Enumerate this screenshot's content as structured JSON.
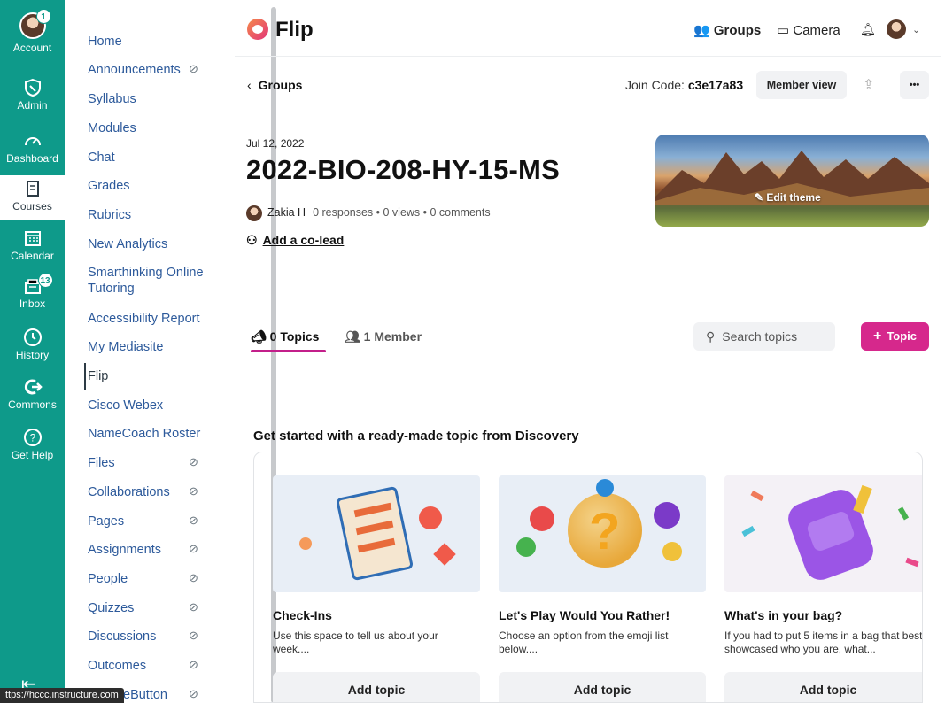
{
  "global_nav": {
    "items": [
      {
        "label": "Account",
        "badge": "1"
      },
      {
        "label": "Admin"
      },
      {
        "label": "Dashboard"
      },
      {
        "label": "Courses"
      },
      {
        "label": "Calendar"
      },
      {
        "label": "Inbox",
        "badge": "13"
      },
      {
        "label": "History"
      },
      {
        "label": "Commons"
      },
      {
        "label": "Get Help"
      }
    ],
    "collapse_icon": "collapse-arrow-icon"
  },
  "course_nav": {
    "items": [
      {
        "label": "Home"
      },
      {
        "label": "Announcements",
        "hidden": true
      },
      {
        "label": "Syllabus"
      },
      {
        "label": "Modules"
      },
      {
        "label": "Chat"
      },
      {
        "label": "Grades"
      },
      {
        "label": "Rubrics"
      },
      {
        "label": "New Analytics"
      },
      {
        "label": "Smarthinking Online Tutoring"
      },
      {
        "label": "Accessibility Report"
      },
      {
        "label": "My Mediasite"
      },
      {
        "label": "Flip",
        "active": true
      },
      {
        "label": "Cisco Webex"
      },
      {
        "label": "NameCoach Roster"
      },
      {
        "label": "Files",
        "hidden": true
      },
      {
        "label": "Collaborations",
        "hidden": true
      },
      {
        "label": "Pages",
        "hidden": true
      },
      {
        "label": "Assignments",
        "hidden": true
      },
      {
        "label": "People",
        "hidden": true
      },
      {
        "label": "Quizzes",
        "hidden": true
      },
      {
        "label": "Discussions",
        "hidden": true
      },
      {
        "label": "Outcomes",
        "hidden": true
      },
      {
        "label": "eButton",
        "hidden": true
      }
    ],
    "status_url": "ttps://hccc.instructure.com"
  },
  "flip": {
    "brand": "Flip",
    "header": {
      "groups": "Groups",
      "camera": "Camera"
    },
    "back_label": "Groups",
    "join_code_label": "Join Code:",
    "join_code": "c3e17a83",
    "member_view": "Member view",
    "more": "•••",
    "date": "Jul 12, 2022",
    "title": "2022-BIO-208-HY-15-MS",
    "author": "Zakia H",
    "stats": "0 responses • 0 views • 0 comments",
    "add_colead": "Add a co-lead",
    "edit_theme": "Edit theme",
    "tabs": {
      "topics": "0 Topics",
      "members": "1 Member"
    },
    "search_placeholder": "Search topics",
    "topic_button": "Topic",
    "discovery_title": "Get started with a ready-made topic from Discovery",
    "cards": [
      {
        "title": "Check-Ins",
        "desc": "Use this space to tell us about your week....",
        "button": "Add topic"
      },
      {
        "title": "Let's Play Would You Rather!",
        "desc": "Choose an option from the emoji list below....",
        "button": "Add topic"
      },
      {
        "title": "What's in your bag?",
        "desc": "If you had to put 5 items in a bag that best showcased who you are, what...",
        "button": "Add topic"
      }
    ]
  },
  "colors": {
    "canvas_teal": "#0e9a8a",
    "flip_pink": "#d6288c",
    "link_blue": "#2d5a9b"
  }
}
